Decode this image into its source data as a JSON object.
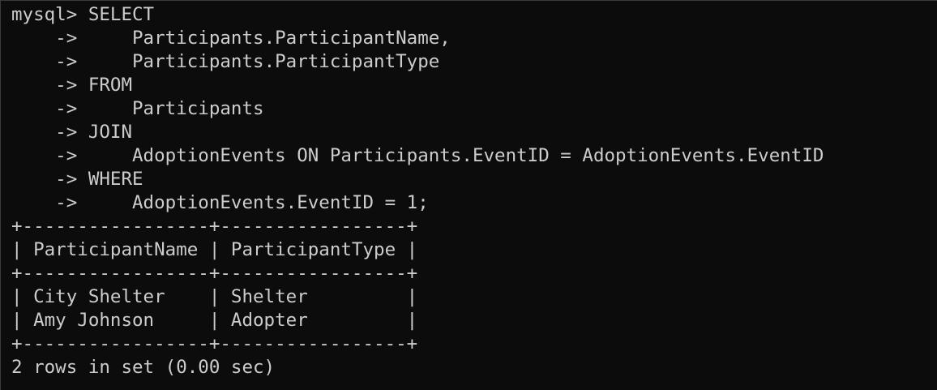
{
  "terminal": {
    "prompt": "mysql> ",
    "continuation": "    -> ",
    "query_lines": [
      "SELECT",
      "    Participants.ParticipantName,",
      "    Participants.ParticipantType",
      "FROM",
      "    Participants",
      "JOIN",
      "    AdoptionEvents ON Participants.EventID = AdoptionEvents.EventID",
      "WHERE",
      "    AdoptionEvents.EventID = 1;"
    ],
    "result": {
      "border": "+-----------------+-----------------+",
      "header": "| ParticipantName | ParticipantType |",
      "rows": [
        "| City Shelter    | Shelter         |",
        "| Amy Johnson     | Adopter         |"
      ]
    },
    "status": "2 rows in set (0.00 sec)"
  },
  "colors": {
    "background": "#0c0c0c",
    "foreground": "#cccccc"
  }
}
